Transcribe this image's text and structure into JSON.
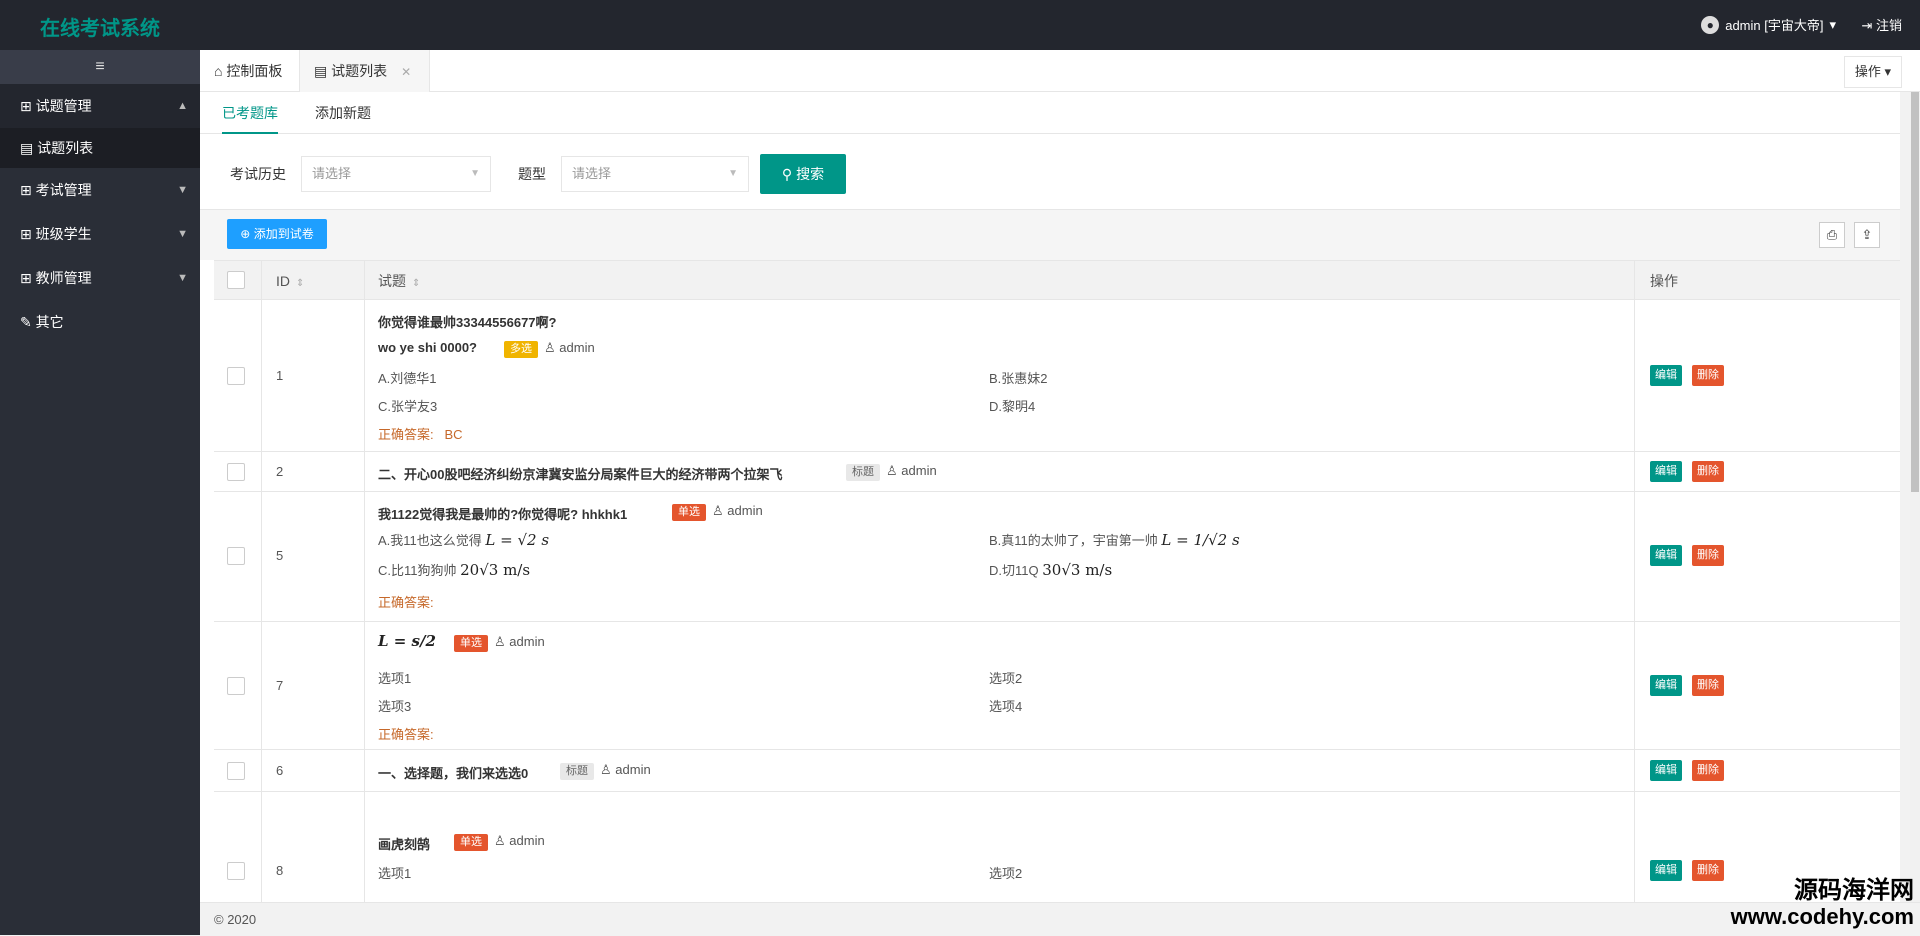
{
  "app": {
    "title": "在线考试系统"
  },
  "header": {
    "user": "admin [宇宙大帝]",
    "logout": "注销"
  },
  "sidebar": {
    "toggle": "≡",
    "items": [
      {
        "label": "试题管理"
      },
      {
        "label": "试题列表"
      },
      {
        "label": "考试管理"
      },
      {
        "label": "班级学生"
      },
      {
        "label": "教师管理"
      },
      {
        "label": "其它"
      }
    ]
  },
  "tabs": [
    {
      "label": "控制面板"
    },
    {
      "label": "试题列表"
    }
  ],
  "ops": "操作",
  "subtabs": [
    {
      "label": "已考题库"
    },
    {
      "label": "添加新题"
    }
  ],
  "filters": {
    "history_label": "考试历史",
    "history_placeholder": "请选择",
    "type_label": "题型",
    "type_placeholder": "请选择",
    "search": "搜索"
  },
  "toolbar": {
    "add": "添加到试卷"
  },
  "table": {
    "headers": {
      "id": "ID",
      "question": "试题",
      "ops": "操作"
    },
    "edit": "编辑",
    "delete": "删除",
    "answer_label": "正确答案:",
    "rows": [
      {
        "id": "1",
        "q1": "你觉得谁最帅33344556677啊?",
        "q2": "wo ye shi 0000?",
        "tag": "多选",
        "author": "admin",
        "opts": [
          "A.刘德华1",
          "B.张惠妹2",
          "C.张学友3",
          "D.黎明4"
        ],
        "answer": "BC"
      },
      {
        "id": "2",
        "q1": "二、开心00股吧经济纠纷京津冀安监分局案件巨大的经济带两个拉架飞",
        "tag": "标题",
        "author": "admin"
      },
      {
        "id": "5",
        "q1": "我1122觉得我是最帅的?你觉得呢? hhkhk1",
        "tag": "单选",
        "author": "admin",
        "opts": [
          "A.我11也这么觉得",
          "B.真11的太帅了，宇宙第一帅",
          "C.比11狗狗帅",
          "D.切11Q"
        ]
      },
      {
        "id": "7",
        "tag": "单选",
        "author": "admin",
        "opts": [
          "选项1",
          "选项2",
          "选项3",
          "选项4"
        ]
      },
      {
        "id": "6",
        "q1": "一、选择题，我们来选选0",
        "tag": "标题",
        "author": "admin"
      },
      {
        "id": "8",
        "q1": "画虎刻鹄",
        "tag": "单选",
        "author": "admin",
        "opts": [
          "选项1",
          "选项2"
        ]
      }
    ]
  },
  "footer": "© 2020",
  "watermark": {
    "line1": "源码海洋网",
    "line2": "www.codehy.com"
  }
}
